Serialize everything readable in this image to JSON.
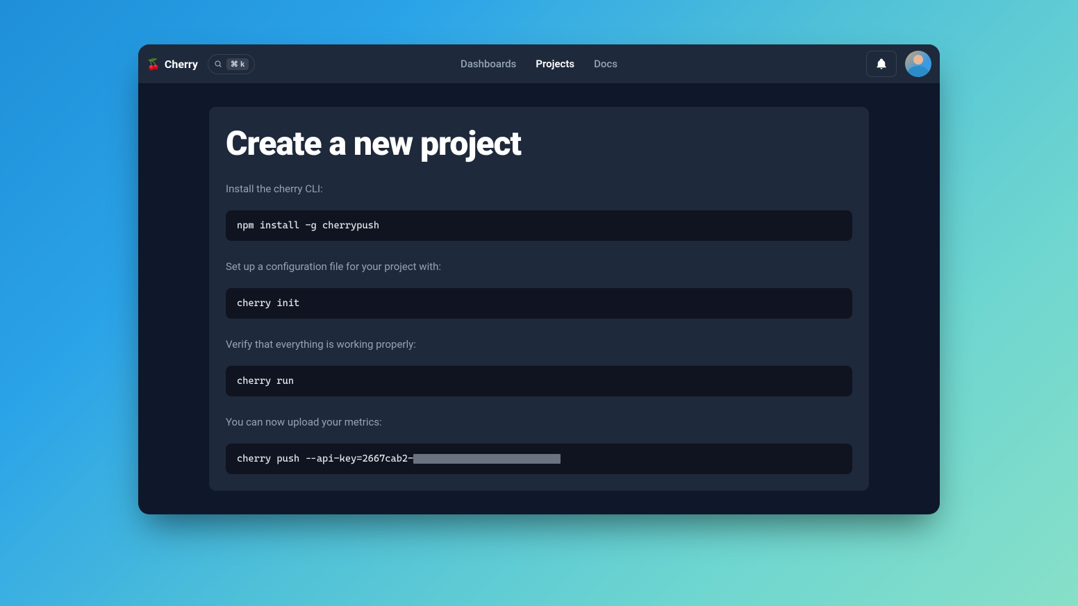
{
  "brand": {
    "emoji": "🍒",
    "name": "Cherry"
  },
  "search": {
    "shortcut": "⌘ k"
  },
  "nav": {
    "dashboards": "Dashboards",
    "projects": "Projects",
    "docs": "Docs",
    "active": "projects"
  },
  "page": {
    "title": "Create a new project",
    "steps": [
      {
        "instruction": "Install the cherry CLI:",
        "code": "npm install -g cherrypush"
      },
      {
        "instruction": "Set up a configuration file for your project with:",
        "code": "cherry init"
      },
      {
        "instruction": "Verify that everything is working properly:",
        "code": "cherry run"
      },
      {
        "instruction": "You can now upload your metrics:",
        "code": "cherry push --api-key=2667cab2-",
        "redacted": true
      }
    ]
  }
}
